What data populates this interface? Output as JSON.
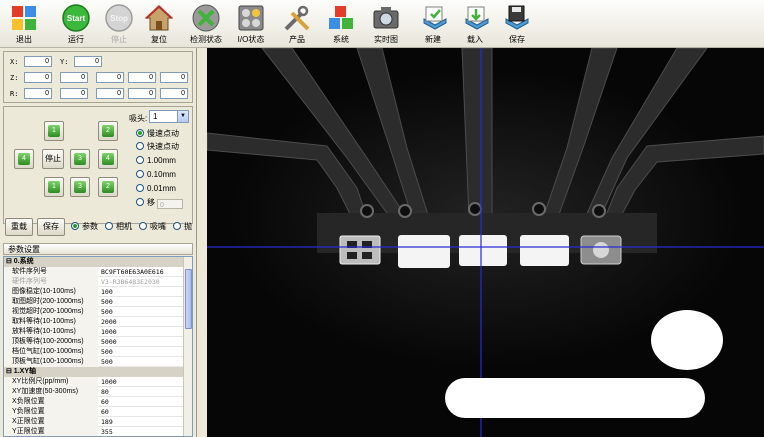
{
  "toolbar": {
    "items": [
      {
        "label": "退出",
        "icon": "exit-icon"
      },
      {
        "label": "运行",
        "icon": "start-icon",
        "badge": "Start"
      },
      {
        "label": "停止",
        "icon": "stop-icon",
        "badge": "Stop",
        "disabled": true
      },
      {
        "label": "复位",
        "icon": "home-icon"
      },
      {
        "label": "检测状态",
        "icon": "detect-status-icon"
      },
      {
        "label": "I/O状态",
        "icon": "io-status-icon"
      },
      {
        "label": "产品",
        "icon": "tools-icon"
      },
      {
        "label": "系统",
        "icon": "system-cubes-icon"
      },
      {
        "label": "实时图",
        "icon": "camera-icon"
      },
      {
        "label": "新建",
        "icon": "new-icon"
      },
      {
        "label": "载入",
        "icon": "load-icon"
      },
      {
        "label": "保存",
        "icon": "save-icon"
      }
    ]
  },
  "coords": {
    "x_label": "X:",
    "y_label": "Y:",
    "z_label": "Z:",
    "r_label": "R:",
    "x": "0",
    "y": "0",
    "z": [
      "0",
      "0",
      "0",
      "0",
      "0"
    ],
    "r": [
      "0",
      "0",
      "0",
      "0",
      "0"
    ]
  },
  "jog": {
    "stop_label": "停止",
    "arrows": {
      "up1": "1",
      "up2": "2",
      "left": "4",
      "right": "3",
      "down1": "1",
      "down2": "2",
      "l2": "4",
      "r2": "3"
    },
    "head_label": "吸头:",
    "head_value": "1",
    "speeds": [
      {
        "label": "慢速点动",
        "checked": true
      },
      {
        "label": "快速点动",
        "checked": false
      },
      {
        "label": "1.00mm",
        "checked": false
      },
      {
        "label": "0.10mm",
        "checked": false
      },
      {
        "label": "0.01mm",
        "checked": false
      },
      {
        "label": "移",
        "checked": false
      }
    ],
    "custom_value": "0"
  },
  "mode": {
    "reload_label": "重载",
    "save_label": "保存",
    "options": [
      {
        "label": "参数",
        "checked": true
      },
      {
        "label": "相机",
        "checked": false
      },
      {
        "label": "吸嘴",
        "checked": false
      },
      {
        "label": "抛",
        "checked": false
      }
    ]
  },
  "params": {
    "title": "参数设置",
    "rows": [
      {
        "k": "⊟ 0.系统",
        "v": "",
        "cat": true
      },
      {
        "k": "软件序列号",
        "v": "BC9FT60E63A0E616"
      },
      {
        "k": "硬件序列号",
        "v": "V3-R3B6483E2030",
        "grey": true
      },
      {
        "k": "图像稳定(10-100ms)",
        "v": "100"
      },
      {
        "k": "取图超时(200-1000ms)",
        "v": "500"
      },
      {
        "k": "视觉超时(200-1000ms)",
        "v": "500"
      },
      {
        "k": "取料等待(10-100ms)",
        "v": "2000"
      },
      {
        "k": "放料等待(10-100ms)",
        "v": "1000"
      },
      {
        "k": "顶板等待(100-2000ms)",
        "v": "5000"
      },
      {
        "k": "档位气缸(100-1000ms)",
        "v": "500"
      },
      {
        "k": "顶板气缸(100-1000ms)",
        "v": "500"
      },
      {
        "k": "⊟ 1.XY轴",
        "v": "",
        "cat": true
      },
      {
        "k": "XY比例尺(pp/mm)",
        "v": "1000"
      },
      {
        "k": "XY加速度(50-300ms)",
        "v": "80"
      },
      {
        "k": "X负限位置",
        "v": "60"
      },
      {
        "k": "Y负限位置",
        "v": "60"
      },
      {
        "k": "X正限位置",
        "v": "189"
      },
      {
        "k": "Y正限位置",
        "v": "355"
      }
    ]
  },
  "colors": {
    "crosshair": "#2a2ad8",
    "toolbar_bg": "#f4f3ec",
    "panel_bg": "#ece9d8",
    "cam_bg": "#060606"
  }
}
